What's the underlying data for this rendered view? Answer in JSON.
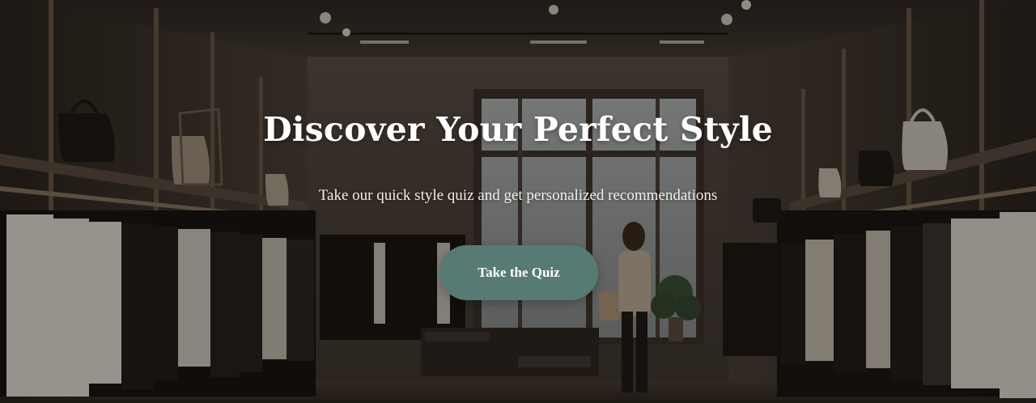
{
  "hero": {
    "title": "Discover Your Perfect Style",
    "subtitle": "Take our quick style quiz and get personalized recommendations",
    "cta_label": "Take the Quiz",
    "background_image": "boutique-interior-photo"
  },
  "colors": {
    "cta_background": "#577a74",
    "text": "#ffffff",
    "overlay": "#0a0806"
  }
}
